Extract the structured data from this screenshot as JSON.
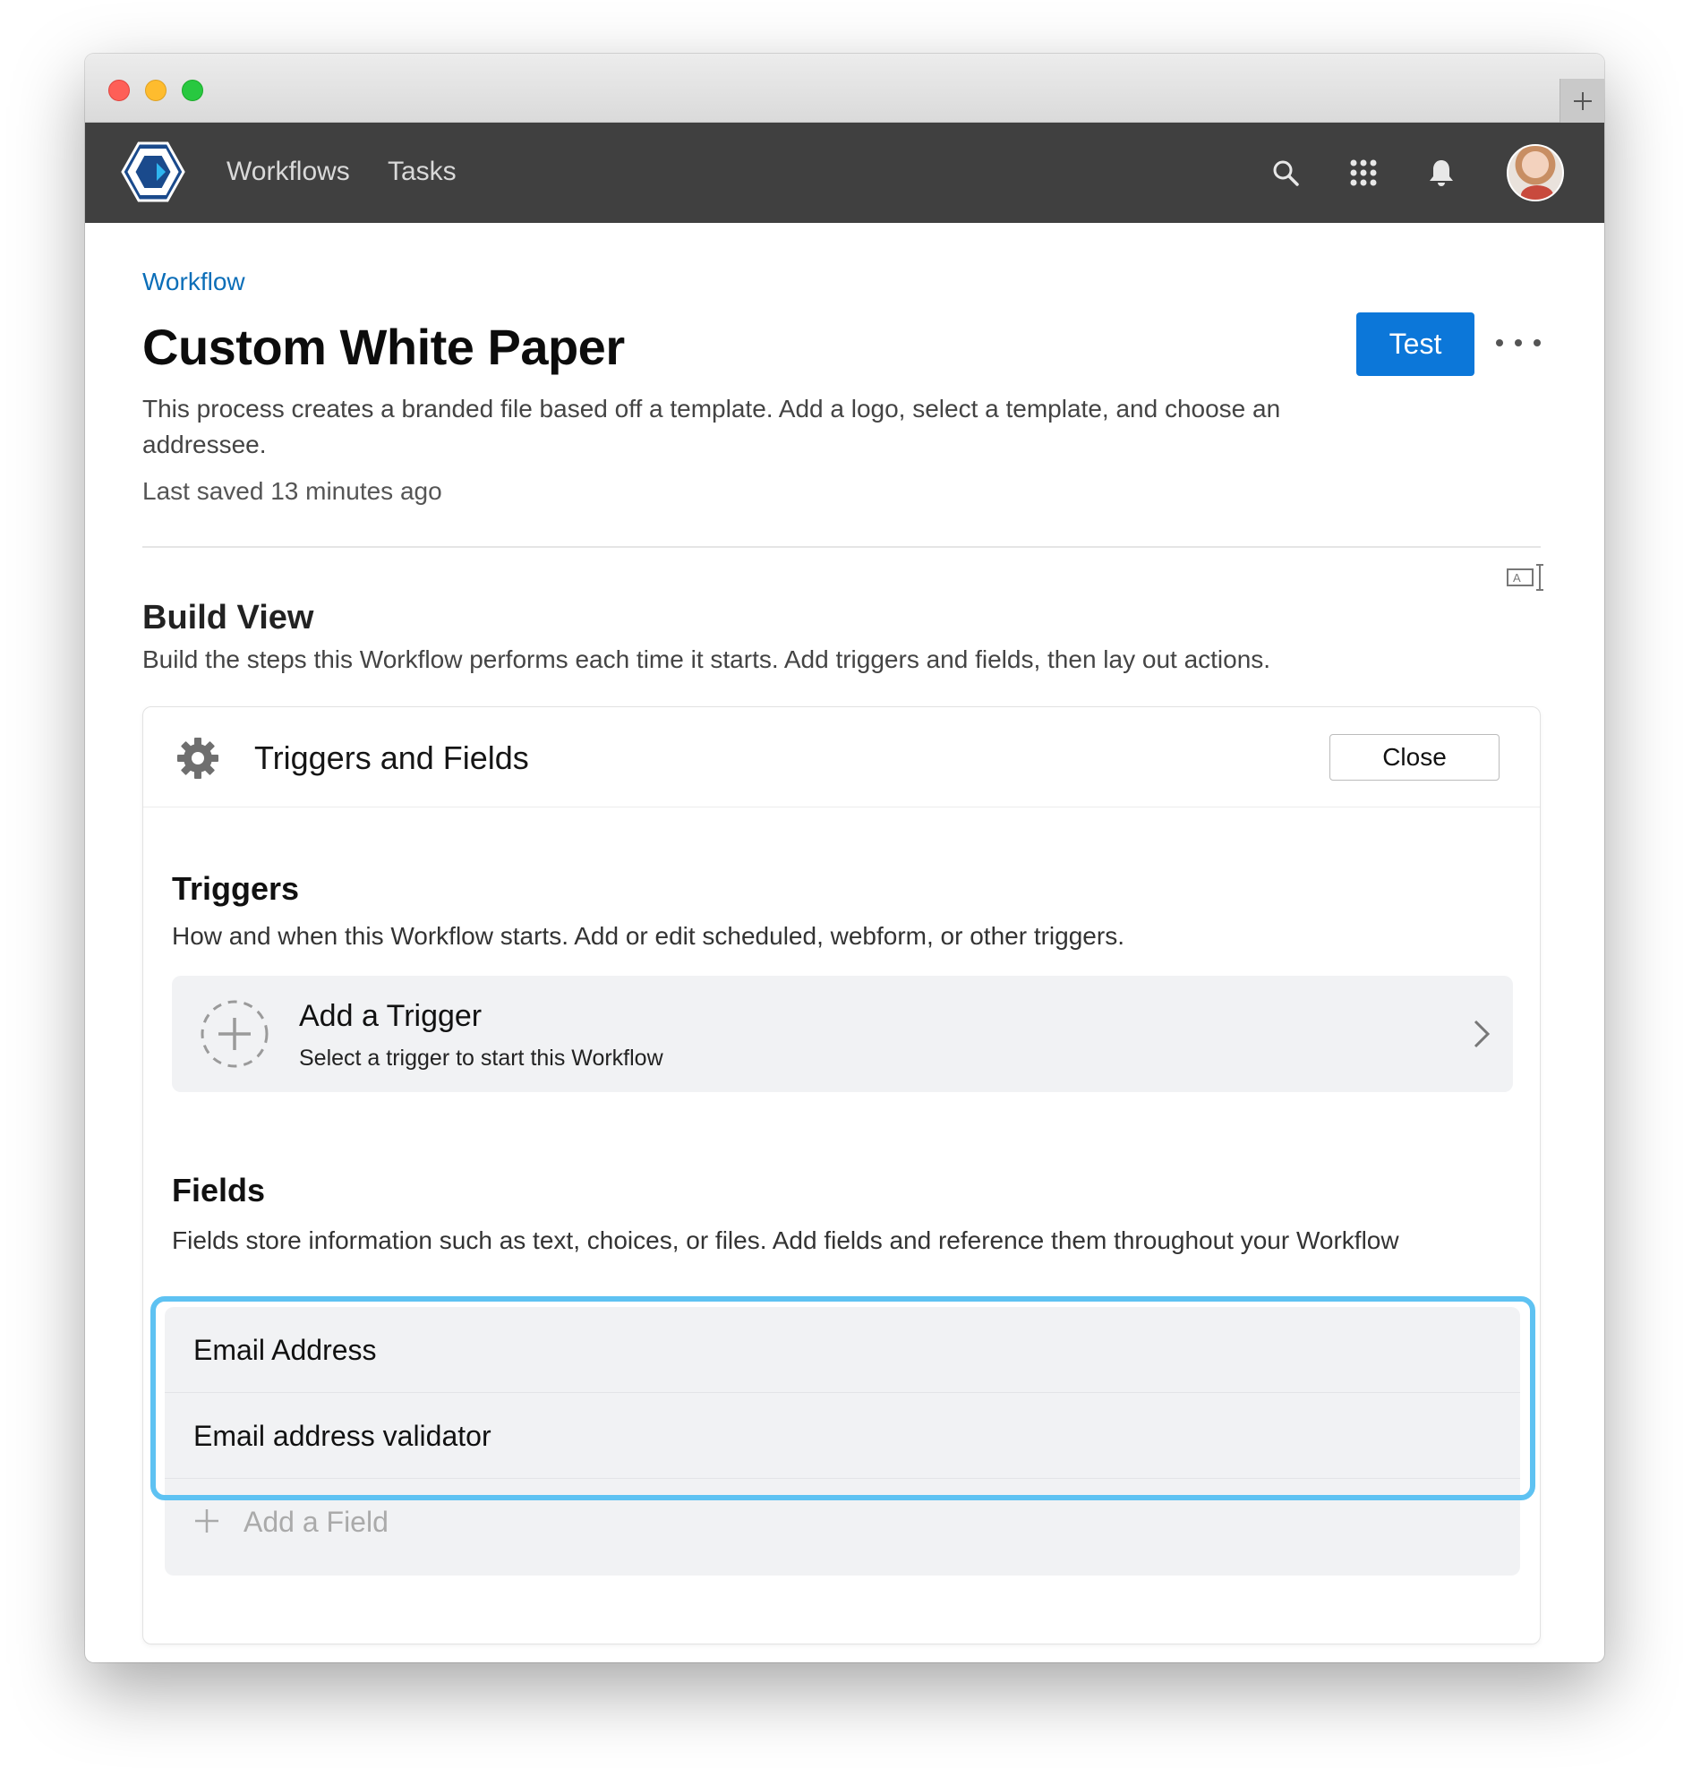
{
  "nav": {
    "links": [
      "Workflows",
      "Tasks"
    ],
    "icons": [
      "search-icon",
      "apps-grid-icon",
      "bell-icon"
    ]
  },
  "header": {
    "breadcrumb": "Workflow",
    "title": "Custom White Paper",
    "test_label": "Test",
    "description": "This process creates a branded file based off a template. Add a logo, select a template, and choose an addressee.",
    "last_saved": "Last saved 13 minutes ago"
  },
  "build_view": {
    "title": "Build View",
    "description": "Build the steps this Workflow performs each time it starts. Add triggers and fields, then lay out actions."
  },
  "panel": {
    "title": "Triggers and Fields",
    "close_label": "Close",
    "triggers": {
      "title": "Triggers",
      "description": "How and when this Workflow starts. Add or edit scheduled, webform, or other triggers.",
      "add_title": "Add a Trigger",
      "add_subtitle": "Select a trigger to start this Workflow"
    },
    "fields": {
      "title": "Fields",
      "description": "Fields store information such as text, choices, or files. Add fields and reference them throughout your Workflow",
      "items": [
        "Email Address",
        "Email address validator"
      ],
      "add_label": "Add a Field"
    }
  },
  "colors": {
    "navbar": "#404040",
    "accent": "#0c77d9",
    "breadcrumb": "#0b6eb8",
    "highlight": "#5ec2f2"
  }
}
